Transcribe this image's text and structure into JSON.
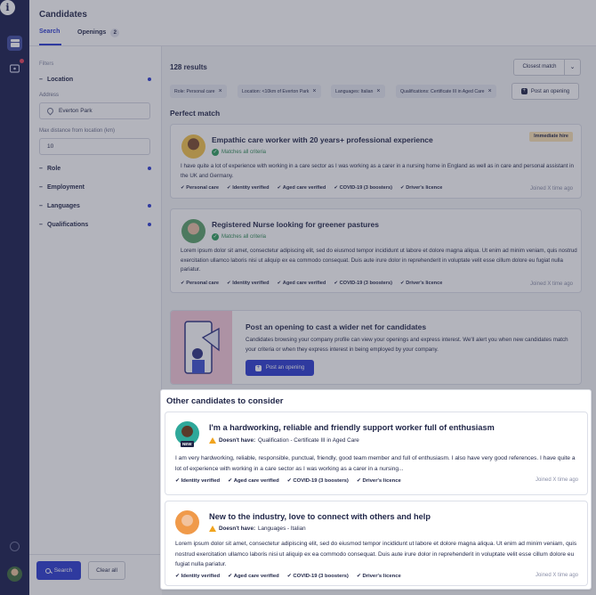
{
  "header": {
    "title": "Candidates",
    "tabs": [
      {
        "label": "Search"
      },
      {
        "label": "Openings",
        "count": "2"
      }
    ]
  },
  "filters": {
    "heading": "Filters",
    "location": {
      "label": "Location",
      "address_label": "Address",
      "address_value": "Everton Park",
      "distance_label": "Max distance from location (km)",
      "distance_value": "10"
    },
    "groups": [
      "Role",
      "Employment",
      "Languages",
      "Qualifications"
    ],
    "search_button": "Search",
    "clear_button": "Clear all"
  },
  "results": {
    "count": "128 results",
    "sort_label": "Closest match",
    "chips": [
      "Role: Personal care",
      "Location: <10km of Everton Park",
      "Languages: Italian",
      "Qualifications: Certificate III in Aged Care"
    ],
    "post_opening": "Post an opening",
    "perfect_match_heading": "Perfect match",
    "perfect_cards": [
      {
        "title": "Empathic care worker with 20 years+ professional experience",
        "match": "Matches all criteria",
        "badge": "Immediate hire",
        "body": "I have quite a lot of experience with working in a care sector as I was working as a carer in a nursing home in England as well as in care and personal assistant in the UK and Germany.",
        "tags": [
          "Personal care",
          "Identity verified",
          "Aged care verified",
          "COVID-19 (3 boosters)",
          "Driver's licence"
        ],
        "joined": "Joined X time ago"
      },
      {
        "title": "Registered Nurse looking for greener pastures",
        "match": "Matches all criteria",
        "body": "Lorem ipsum dolor sit amet, consectetur adipiscing elit, sed do eiusmod tempor incididunt ut labore et dolore magna aliqua. Ut enim ad minim veniam, quis nostrud exercitation ullamco laboris nisi ut aliquip ex ea commodo consequat. Duis aute irure dolor in reprehenderit in voluptate velit esse cillum dolore eu fugiat nulla pariatur.",
        "tags": [
          "Personal care",
          "Identity verified",
          "Aged care verified",
          "COVID-19 (3 boosters)",
          "Driver's licence"
        ],
        "joined": "Joined X time ago"
      }
    ],
    "promo": {
      "title": "Post an opening to cast a wider net for candidates",
      "body": "Candidates browsing your company profile can view your openings and express interest. We'll alert you when new candidates match your criteria or when they express interest in being employed by your company.",
      "button": "Post an opening"
    }
  },
  "other": {
    "heading": "Other candidates to consider",
    "cards": [
      {
        "title": "I'm a hardworking, reliable and friendly support worker full of enthusiasm",
        "new_tag": "NEW",
        "doesnt_label": "Doesn't have:",
        "doesnt_value": "Qualification - Certificate III in Aged Care",
        "body": "I am very hardworking, reliable, responsible, punctual, friendly, good team member and full of enthusiasm. I also have very good references. I have quite a lot of experience with working in a care sector as I was working as a carer in a nursing...",
        "tags": [
          "Identity verified",
          "Aged care verified",
          "COVID-19 (3 boosters)",
          "Driver's licence"
        ],
        "joined": "Joined X time ago"
      },
      {
        "title": "New to the industry, love to connect with others and help",
        "doesnt_label": "Doesn't have:",
        "doesnt_value": "Languages - Italian",
        "body": "Lorem ipsum dolor sit amet, consectetur adipiscing elit, sed do eiusmod tempor incididunt ut labore et dolore magna aliqua. Ut enim ad minim veniam, quis nostrud exercitation ullamco laboris nisi ut aliquip ex ea commodo consequat. Duis aute irure dolor in reprehenderit in voluptate velit esse cillum dolore eu fugiat nulla pariatur.",
        "tags": [
          "Identity verified",
          "Aged care verified",
          "COVID-19 (3 boosters)",
          "Driver's licence"
        ],
        "joined": "Joined X time ago"
      }
    ]
  },
  "colors": {
    "brand": "#2b3bd1",
    "rail": "#171c4d",
    "success": "#2e9e5e",
    "warning": "#f1a41e"
  },
  "icons": [
    "info-icon",
    "candidates-icon",
    "messages-icon",
    "help-icon",
    "user-avatar",
    "pin-icon",
    "chevron-down-icon",
    "close-icon",
    "plus-icon",
    "search-icon",
    "check-icon",
    "warning-icon"
  ]
}
